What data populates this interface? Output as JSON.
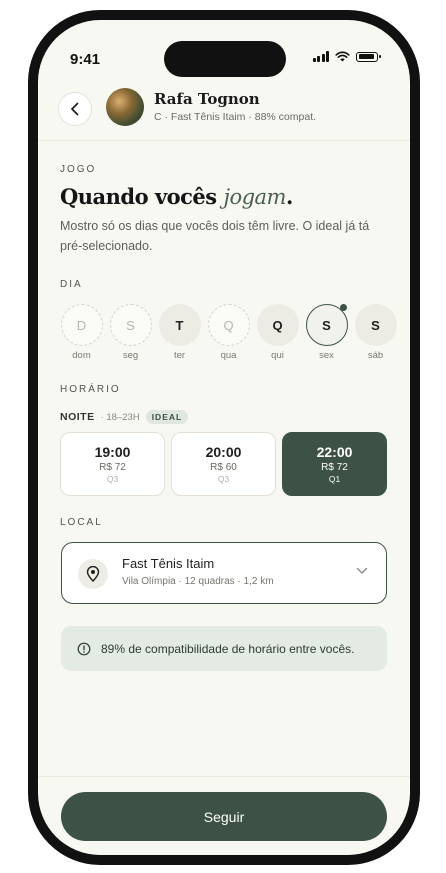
{
  "status_bar": {
    "time": "9:41"
  },
  "header": {
    "name": "Rafa Tognon",
    "subtitle": "C · Fast Tênis Itaim · 88% compat."
  },
  "jogo": {
    "label": "JOGO",
    "title_start": "Quando vocês ",
    "title_emphasis": "jogam",
    "title_end": ".",
    "description": "Mostro só os dias que vocês dois têm livre. O ideal já tá pré-selecionado."
  },
  "dia": {
    "label": "DIA",
    "days": [
      {
        "letter": "D",
        "name": "dom",
        "state": "unavailable"
      },
      {
        "letter": "S",
        "name": "seg",
        "state": "unavailable"
      },
      {
        "letter": "T",
        "name": "ter",
        "state": "available"
      },
      {
        "letter": "Q",
        "name": "qua",
        "state": "unavailable"
      },
      {
        "letter": "Q",
        "name": "qui",
        "state": "available"
      },
      {
        "letter": "S",
        "name": "sex",
        "state": "selected"
      },
      {
        "letter": "S",
        "name": "sáb",
        "state": "available"
      }
    ]
  },
  "horario": {
    "label": "HORÁRIO",
    "period_name": "NOITE",
    "period_range": "· 18–23H",
    "ideal_badge": "IDEAL",
    "slots": [
      {
        "time": "19:00",
        "price": "R$ 72",
        "quadra": "Q3",
        "selected": false
      },
      {
        "time": "20:00",
        "price": "R$ 60",
        "quadra": "Q3",
        "selected": false
      },
      {
        "time": "22:00",
        "price": "R$ 72",
        "quadra": "Q1",
        "selected": true
      }
    ]
  },
  "local": {
    "label": "LOCAL",
    "name": "Fast Tênis Itaim",
    "details": "Vila Olímpia · 12 quadras · 1,2 km"
  },
  "info": {
    "text": "89% de compatibilidade de horário entre vocês."
  },
  "footer": {
    "cta": "Seguir"
  },
  "colors": {
    "primary": "#3d5244",
    "background": "#f8f8f2",
    "accent_soft": "#e4ebe4"
  }
}
